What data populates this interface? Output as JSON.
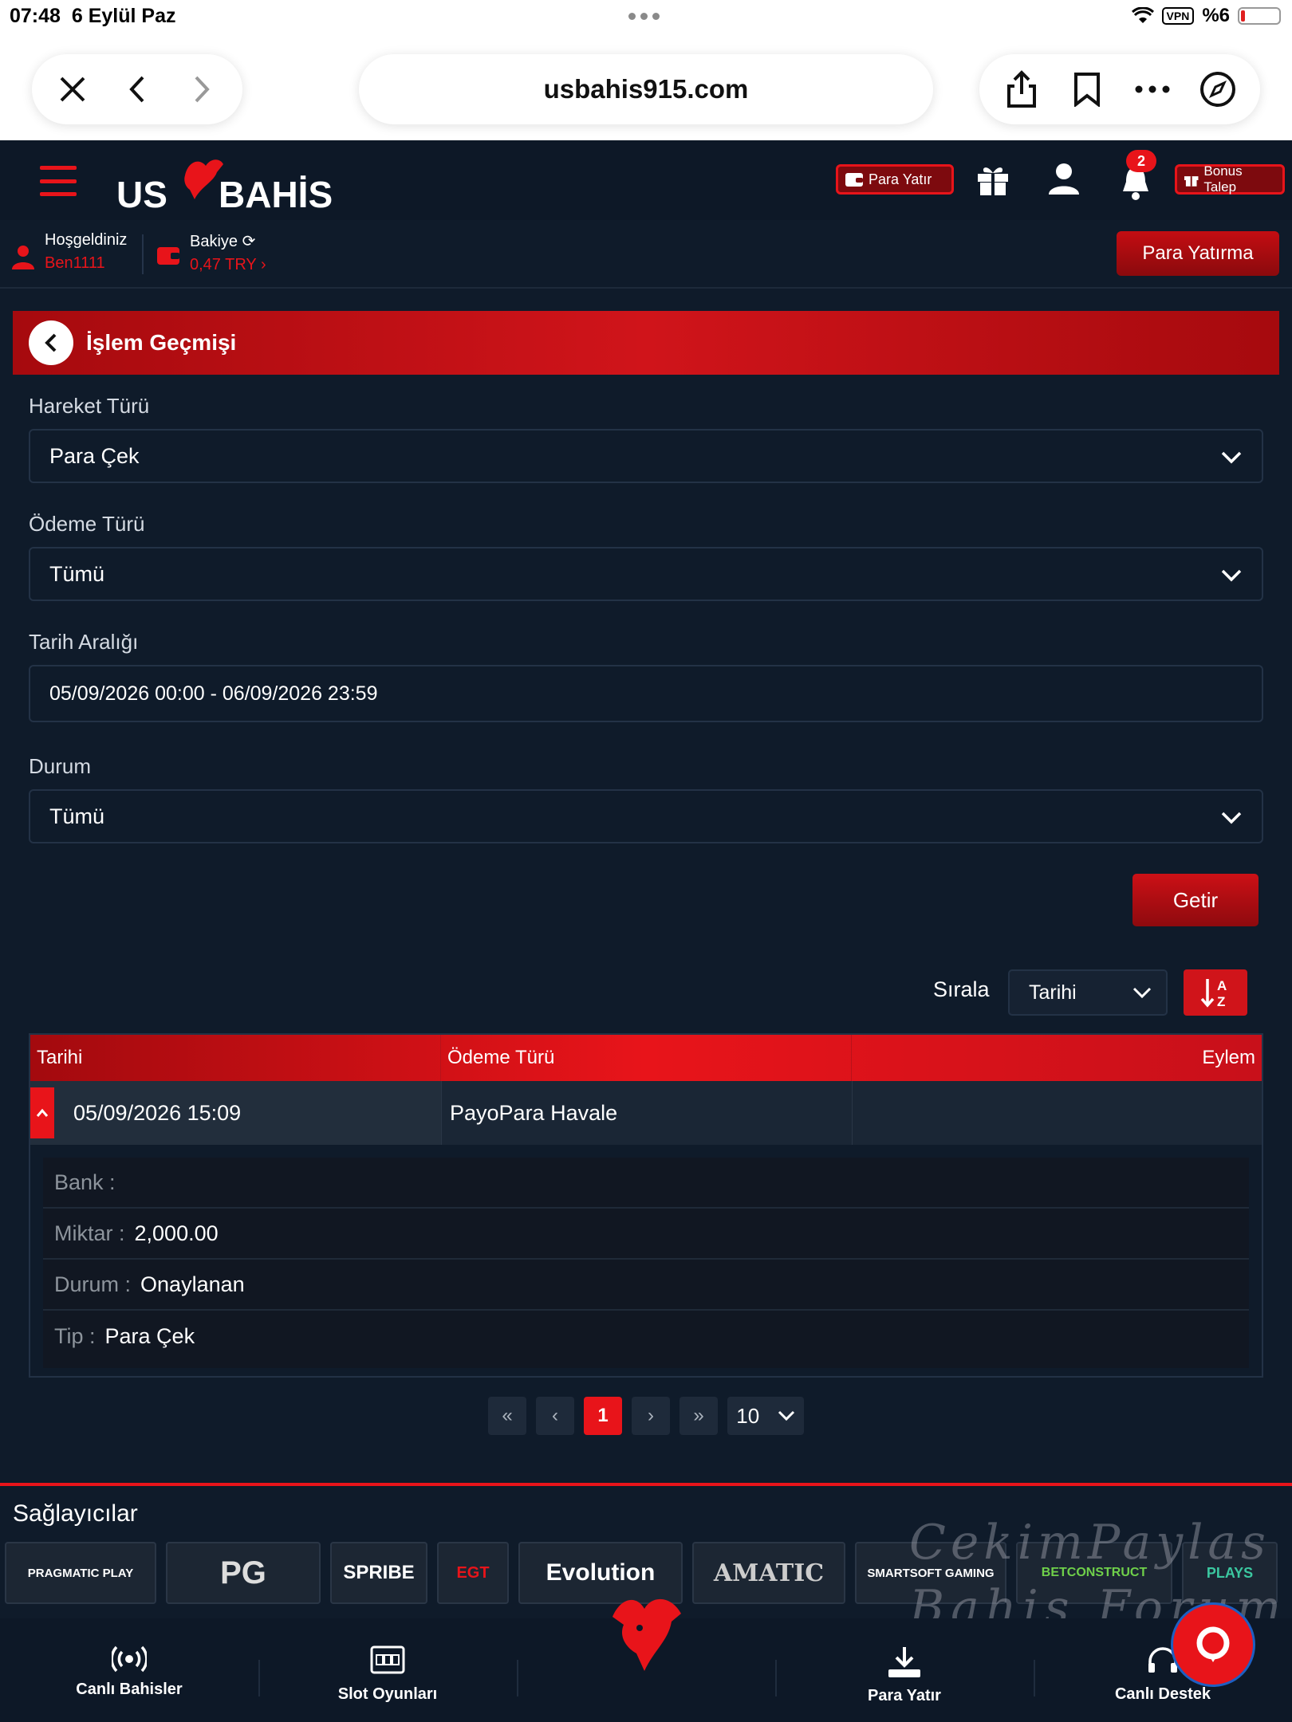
{
  "status_bar": {
    "time": "07:48",
    "date": "6 Eylül Paz",
    "vpn": "VPN",
    "battery": "%6"
  },
  "browser": {
    "url": "usbahis915.com"
  },
  "header": {
    "logo_left": "US",
    "logo_right": "BAHİS",
    "deposit_button": "Para Yatır",
    "notification_count": "2",
    "bonus_button": "Bonus Talep"
  },
  "welcome": {
    "greeting": "Hoşgeldiniz",
    "username": "Ben1111",
    "balance_label": "Bakiye",
    "balance_value": "0,47 TRY",
    "deposit_cta": "Para Yatırma"
  },
  "panel": {
    "title": "İşlem Geçmişi",
    "filters": {
      "movement_label": "Hareket Türü",
      "movement_value": "Para Çek",
      "payment_label": "Ödeme Türü",
      "payment_value": "Tümü",
      "date_label": "Tarih Aralığı",
      "date_value": "05/09/2026 00:00 - 06/09/2026 23:59",
      "status_label": "Durum",
      "status_value": "Tümü"
    },
    "fetch_button": "Getir",
    "sort_label": "Sırala",
    "sort_value": "Tarihi",
    "table": {
      "columns": [
        "Tarihi",
        "Ödeme Türü",
        "Eylem"
      ],
      "row": {
        "date": "05/09/2026 15:09",
        "payment": "PayoPara Havale",
        "action": ""
      },
      "details": [
        {
          "key": "Bank :",
          "value": ""
        },
        {
          "key": "Miktar :",
          "value": "2,000.00"
        },
        {
          "key": "Durum :",
          "value": "Onaylanan"
        },
        {
          "key": "Tip :",
          "value": "Para Çek"
        }
      ]
    },
    "pagination": {
      "first": "«",
      "prev": "‹",
      "current": "1",
      "next": "›",
      "last": "»",
      "page_size": "10"
    }
  },
  "providers": {
    "title": "Sağlayıcılar",
    "items": [
      "PRAGMATIC PLAY",
      "PG",
      "SPRIBE",
      "EGT",
      "Evolution",
      "AMATIC",
      "SMARTSOFT GAMING",
      "BETCONSTRUCT",
      "PLAYS"
    ]
  },
  "watermark": {
    "line1": "CekimPaylas",
    "line2": "Bahis Forum"
  },
  "bottom_nav": {
    "live_bets": "Canlı Bahisler",
    "slots": "Slot Oyunları",
    "deposit": "Para Yatır",
    "support": "Canlı Destek"
  },
  "colors": {
    "accent": "#e8141a",
    "background": "#0f1b2a",
    "header_bg": "#0d1827"
  },
  "icons": [
    "close-icon",
    "back-arrow-icon",
    "forward-arrow-icon",
    "share-icon",
    "bookmark-icon",
    "more-icon",
    "compass-icon",
    "menu-icon",
    "gift-icon",
    "user-icon",
    "bell-icon",
    "wallet-icon",
    "refresh-icon",
    "chevron-down-icon",
    "sort-az-icon",
    "broadcast-icon",
    "slot-icon",
    "download-icon",
    "headset-icon",
    "chat-icon"
  ]
}
